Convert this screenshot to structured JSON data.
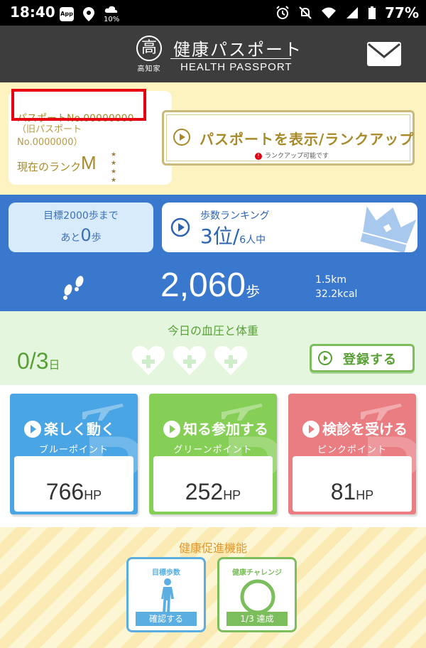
{
  "status_bar": {
    "time": "18:40",
    "app_badge": "App",
    "weather_value": "10%",
    "battery": "77%"
  },
  "header": {
    "logo_char": "高",
    "logo_sub": "高知家",
    "title_jp": "健康パスポート",
    "title_en": "HEALTH PASSPORT",
    "mail_icon": "mail-icon"
  },
  "passport": {
    "number": "パスポートNo.00000000",
    "old_number": "（旧パスポート No.0000000）",
    "rank_label": "現在のランク",
    "rank_value": "M",
    "stars": "★ ★ ★ ★",
    "button_label": "パスポートを表示/ランクアップ",
    "button_note": "ランクアップ可能です"
  },
  "steps": {
    "goal_top": "目標2000歩まで",
    "goal_prefix": "あと",
    "goal_remaining": "0",
    "goal_unit": "歩",
    "ranking_label": "歩数ランキング",
    "rank_position": "3位/",
    "rank_total": "6人中",
    "count": "2,060",
    "count_unit": "歩",
    "distance": "1.5km",
    "calories": "32.2kcal"
  },
  "blood_pressure": {
    "title": "今日の血圧と体重",
    "count": "0/3",
    "count_unit": "日",
    "register_label": "登録する"
  },
  "points": [
    {
      "title": "楽しく動く",
      "subtitle": "ブルーポイント",
      "value": "766",
      "unit": "HP",
      "color": "#4aa5e4"
    },
    {
      "title": "知る参加する",
      "subtitle": "グリーンポイント",
      "value": "252",
      "unit": "HP",
      "color": "#86cf56"
    },
    {
      "title": "検診を受ける",
      "subtitle": "ピンクポイント",
      "value": "81",
      "unit": "HP",
      "color": "#ea7d82"
    }
  ],
  "promo": {
    "title": "健康促進機能",
    "goal_caption": "目標歩数",
    "goal_button": "確認する",
    "challenge_caption": "健康チャレンジ",
    "challenge_button": "1/3 達成"
  }
}
